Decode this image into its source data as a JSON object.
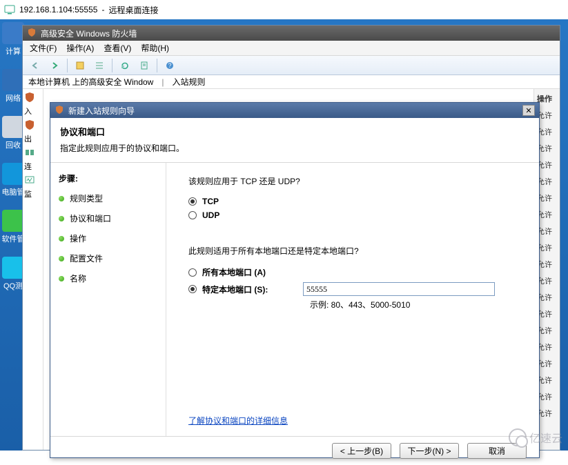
{
  "rdp": {
    "address": "192.168.1.104:55555",
    "title_suffix": "远程桌面连接"
  },
  "desktop_icons": [
    {
      "label": "计算",
      "color": "#3a7bc8"
    },
    {
      "label": "网络",
      "color": "#2f6fb8"
    },
    {
      "label": "回收",
      "color": "#d0d7e0"
    },
    {
      "label": "电脑管",
      "color": "#1296db"
    },
    {
      "label": "软件管",
      "color": "#3cc24a"
    },
    {
      "label": "QQ测",
      "color": "#18c0ea"
    }
  ],
  "firewall": {
    "title": "高级安全 Windows 防火墙",
    "menu": [
      "文件(F)",
      "操作(A)",
      "查看(V)",
      "帮助(H)"
    ],
    "path": "本地计算机 上的高级安全 Window",
    "path_extra": "入站规则",
    "tree_labels": [
      "入",
      "出",
      "连",
      "监"
    ],
    "actions_header": "操作",
    "action_allow": "允许"
  },
  "wizard": {
    "title": "新建入站规则向导",
    "header_title": "协议和端口",
    "header_desc": "指定此规则应用于的协议和端口。",
    "steps_heading": "步骤:",
    "steps": [
      "规则类型",
      "协议和端口",
      "操作",
      "配置文件",
      "名称"
    ],
    "active_step": 1,
    "q_protocol": "该规则应用于 TCP 还是 UDP?",
    "opt_tcp": "TCP",
    "opt_udp": "UDP",
    "protocol_selected": "tcp",
    "q_ports": "此规则适用于所有本地端口还是特定本地端口?",
    "opt_all_ports": "所有本地端口 (A)",
    "opt_specific_ports": "特定本地端口 (S):",
    "ports_selected": "specific",
    "port_value": "55555",
    "example": "示例: 80、443、5000-5010",
    "learn_more": "了解协议和端口的详细信息",
    "btn_back": "< 上一步(B)",
    "btn_next": "下一步(N) >",
    "btn_cancel": "取消"
  },
  "watermark": "亿速云"
}
